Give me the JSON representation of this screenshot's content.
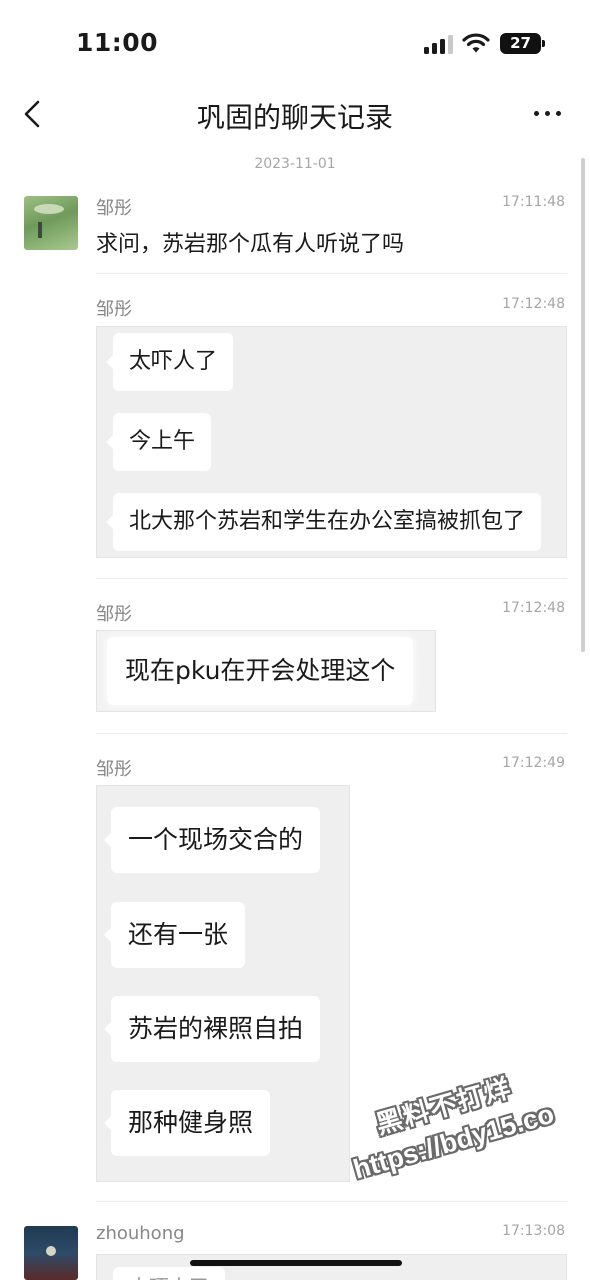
{
  "status_bar": {
    "time": "11:00",
    "battery": "27"
  },
  "nav": {
    "title": "巩固的聊天记录"
  },
  "date": "2023-11-01",
  "messages": [
    {
      "sender": "邹彤",
      "time": "17:11:48",
      "text": "求问，苏岩那个瓜有人听说了吗"
    },
    {
      "sender": "邹彤",
      "time": "17:12:48",
      "bubbles": [
        "太吓人了",
        "今上午",
        "北大那个苏岩和学生在办公室搞被抓包了"
      ]
    },
    {
      "sender": "邹彤",
      "time": "17:12:48",
      "bubbles": [
        "现在pku在开会处理这个"
      ]
    },
    {
      "sender": "邹彤",
      "time": "17:12:49",
      "bubbles": [
        "一个现场交合的",
        "还有一张",
        "苏岩的裸照自拍",
        "那种健身照"
      ]
    },
    {
      "sender": "zhouhong",
      "time": "17:13:08",
      "bubbles": [
        "太吓人了"
      ]
    }
  ],
  "watermark": {
    "line1": "黑料不打烊",
    "line2": "https://bdy15.co"
  }
}
